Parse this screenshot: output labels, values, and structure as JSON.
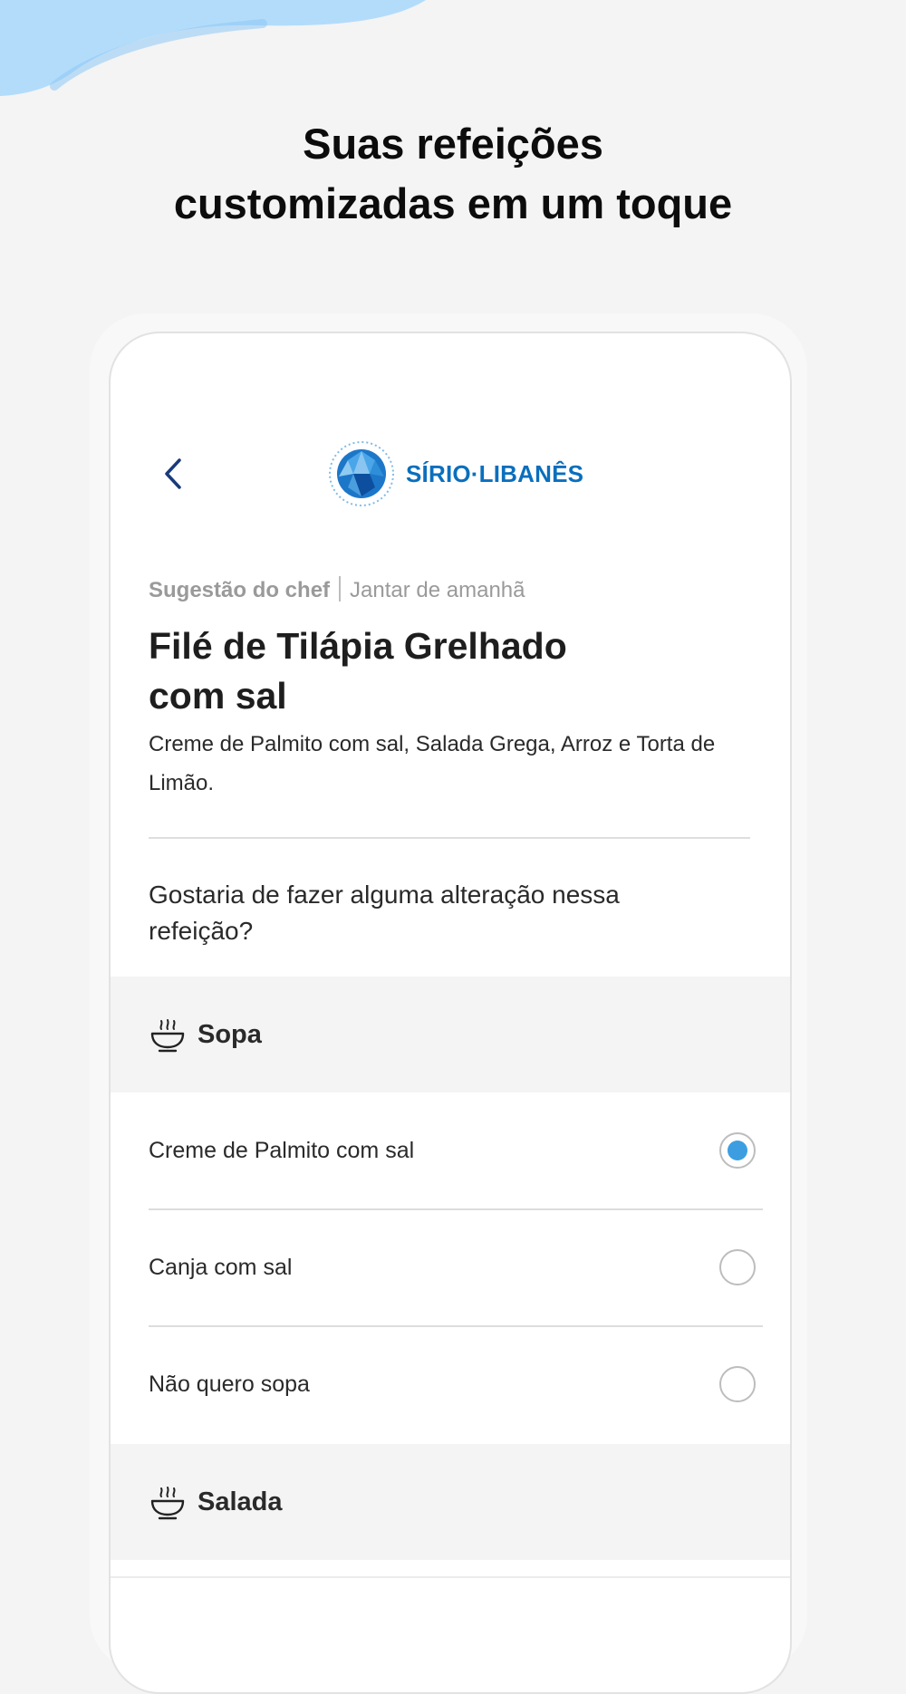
{
  "headline": {
    "line1": "Suas refeições",
    "line2": "customizadas em um toque"
  },
  "colors": {
    "background": "#f4f4f4",
    "wave": "#b3dcfb",
    "brand_blue": "#0a6fbd",
    "navy": "#1a3a7a",
    "radio_selected": "#3c9ee0"
  },
  "header": {
    "back_icon": "chevron-left-icon",
    "logo_text": "SÍRIO·LIBANÊS"
  },
  "meal": {
    "suggestion_label": "Sugestão do chef",
    "when_label": "Jantar de amanhã",
    "title_line1": "Filé de Tilápia Grelhado",
    "title_line2": "com sal",
    "description": "Creme de Palmito com sal, Salada Grega, Arroz e Torta de Limão.",
    "question": "Gostaria de fazer alguma alteração nessa refeição?"
  },
  "sections": [
    {
      "label": "Sopa",
      "icon": "soup-bowl-icon",
      "options": [
        {
          "label": "Creme de Palmito com sal",
          "selected": true
        },
        {
          "label": "Canja com sal",
          "selected": false
        },
        {
          "label": "Não quero sopa",
          "selected": false
        }
      ]
    },
    {
      "label": "Salada",
      "icon": "soup-bowl-icon"
    }
  ]
}
